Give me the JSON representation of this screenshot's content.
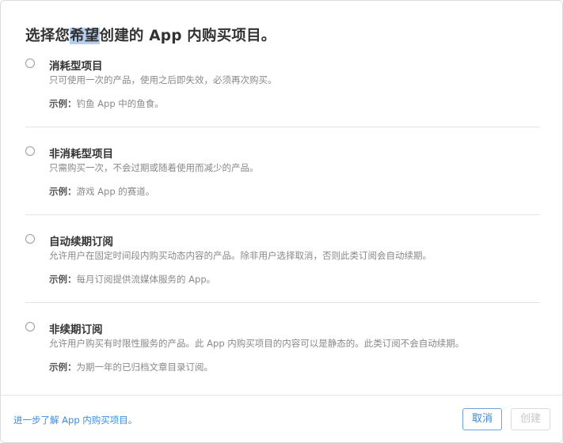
{
  "dialog": {
    "title_before": "选择您",
    "title_highlight": "希望",
    "title_after": "创建的 App 内购买项目。"
  },
  "options": [
    {
      "name": "消耗型项目",
      "description": "只可使用一次的产品，使用之后即失效，必须再次购买。",
      "example_label": "示例：",
      "example_text": "钓鱼 App 中的鱼食。"
    },
    {
      "name": "非消耗型项目",
      "description": "只需购买一次，不会过期或随着使用而减少的产品。",
      "example_label": "示例：",
      "example_text": "游戏 App 的赛道。"
    },
    {
      "name": "自动续期订阅",
      "description": "允许用户在固定时间段内购买动态内容的产品。除非用户选择取消，否则此类订阅会自动续期。",
      "example_label": "示例：",
      "example_text": "每月订阅提供流媒体服务的 App。"
    },
    {
      "name": "非续期订阅",
      "description": "允许用户购买有时限性服务的产品。此 App 内购买项目的内容可以是静态的。此类订阅不会自动续期。",
      "example_label": "示例：",
      "example_text": "为期一年的已归档文章目录订阅。"
    }
  ],
  "footer": {
    "learn_more": "进一步了解 App 内购买项目。",
    "cancel_label": "取消",
    "create_label": "创建"
  },
  "colors": {
    "link": "#3b8de0",
    "selection_highlight": "#b7cfee",
    "disabled_text": "#c6c6c6"
  }
}
